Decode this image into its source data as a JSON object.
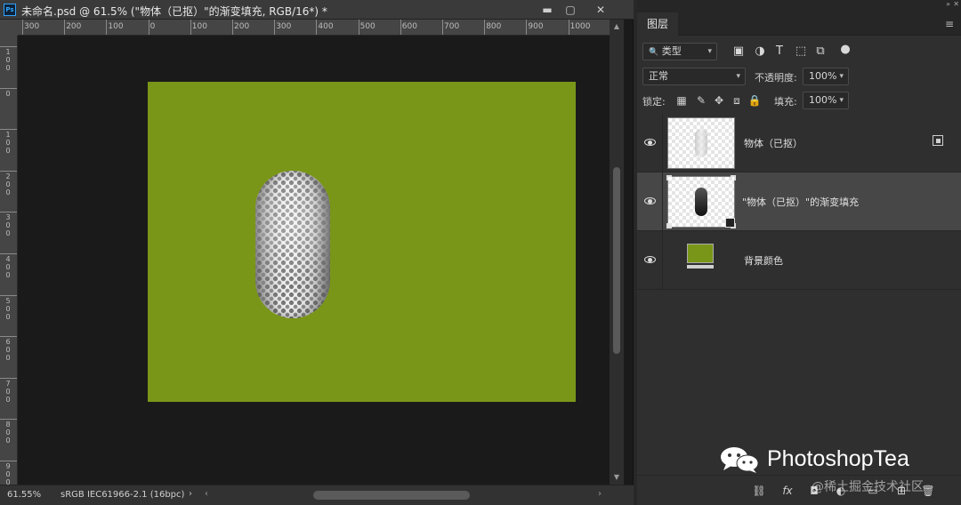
{
  "document": {
    "app_badge": "Ps",
    "title": "未命名.psd @ 61.5% (\"物体（已抠）\"的渐变填充, RGB/16*) *",
    "window_controls": {
      "minimize": "▬",
      "restore": "▢",
      "close": "✕"
    },
    "ruler_top": [
      "300",
      "200",
      "100",
      "0",
      "100",
      "200",
      "300",
      "400",
      "500",
      "600",
      "700",
      "800",
      "900",
      "1000"
    ],
    "ruler_left": [
      "100",
      "0",
      "100",
      "200",
      "300",
      "400",
      "500",
      "600",
      "700",
      "800",
      "900"
    ],
    "canvas_color": "#7a9618",
    "status": {
      "zoom": "61.55%",
      "color_profile": "sRGB IEC61966-2.1 (16bpc)",
      "menu_arrow": "›",
      "scroll_left": "‹",
      "scroll_right": "›"
    },
    "scroll_up": "▲",
    "scroll_down": "▼"
  },
  "layers_panel": {
    "collapse_glyph": "»",
    "close_glyph": "✕",
    "tab_label": "图层",
    "menu_glyph": "≡",
    "filter": {
      "search_glyph": "🔍",
      "kind_label": "类型",
      "caret": "▾",
      "icons": {
        "pixel": "▣",
        "adjustment": "◑",
        "type": "T",
        "shape": "⬚",
        "smart": "⧉",
        "toggle": "●"
      }
    },
    "blend_mode": "正常",
    "opacity_label": "不透明度:",
    "opacity_value": "100%",
    "lock_label": "锁定:",
    "lock_icons": {
      "transparency": "▦",
      "paint": "✎",
      "move": "✥",
      "artboard": "⧈",
      "all": "🔒"
    },
    "fill_label": "填充:",
    "fill_value": "100%",
    "layers": [
      {
        "name": "物体（已抠）",
        "type": "smart-object"
      },
      {
        "name": "\"物体（已抠）\"的渐变填充",
        "type": "gradient-fill",
        "selected": true
      },
      {
        "name": "背景颜色",
        "type": "solid-color"
      }
    ],
    "bottom_icons": {
      "link": "⛓",
      "fx": "fx",
      "mask": "◘",
      "adjust": "◐",
      "group": "▭",
      "new": "⊞",
      "delete": "🗑"
    }
  },
  "watermark": {
    "brand": "PhotoshopTea",
    "credit": "@稀土掘金技术社区"
  }
}
